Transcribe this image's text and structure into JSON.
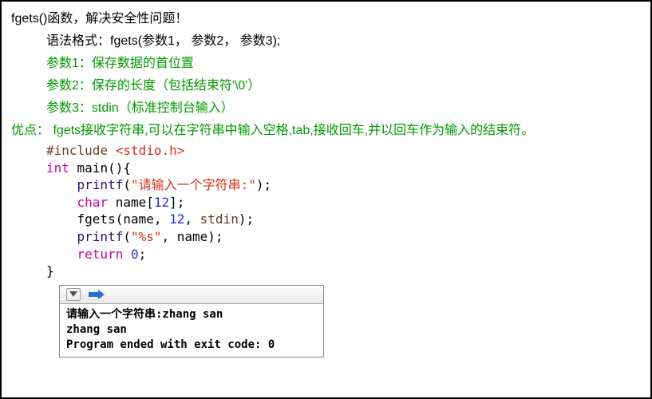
{
  "title": "fgets()函数，解决安全性问题！",
  "syntax": "语法格式：fgets(参数1， 参数2， 参数3);",
  "params": {
    "p1": "参数1：保存数据的首位置",
    "p2": "参数2：保存的长度（包括结束符'\\0'）",
    "p3": "参数3：stdin（标准控制台输入）"
  },
  "advantage": "优点： fgets接收字符串,可以在字符串中输入空格,tab,接收回车,并以回车作为输入的结束符。",
  "code": {
    "l1_inc": "#include ",
    "l1_hdr": "<stdio.h>",
    "l2_kw": "int",
    "l2_rest": " main(){",
    "l3_indent": "    ",
    "l3_fn": "printf",
    "l3_open": "(",
    "l3_str": "\"请输入一个字符串:\"",
    "l3_close": ");",
    "l4_indent": "    ",
    "l4_kw": "char",
    "l4_mid": " name[",
    "l4_num": "12",
    "l4_end": "];",
    "l5_indent": "    fgets(name, ",
    "l5_num": "12",
    "l5_mid": ", ",
    "l5_std": "stdin",
    "l5_end": ");",
    "l6_indent": "    ",
    "l6_fn": "printf",
    "l6_open": "(",
    "l6_str": "\"%s\"",
    "l6_rest": ", name);",
    "l7_indent": "    ",
    "l7_kw": "return",
    "l7_sp": " ",
    "l7_num": "0",
    "l7_end": ";",
    "l8": "}"
  },
  "console": {
    "line1": "请输入一个字符串:zhang san",
    "line2": "zhang san",
    "line3": "Program ended with exit code: 0"
  }
}
